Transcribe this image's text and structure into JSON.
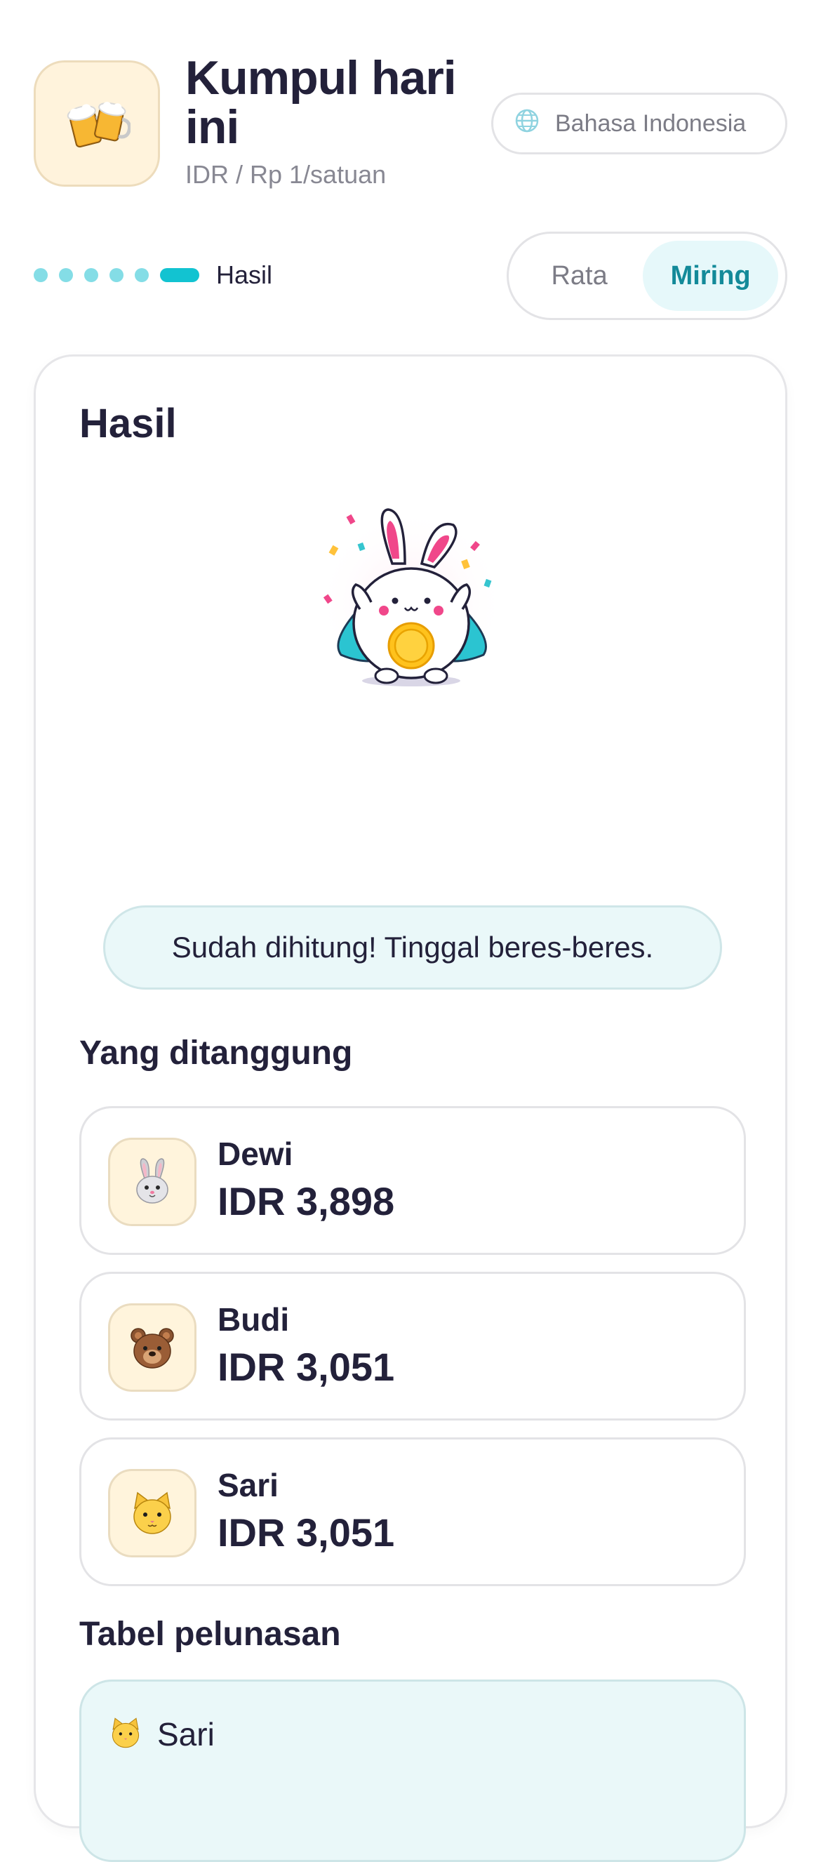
{
  "header": {
    "app_icon": "beer-mugs-icon",
    "title": "Kumpul hari ini",
    "subtitle": "IDR / Rp 1/satuan",
    "language": "Bahasa Indonesia"
  },
  "steps": {
    "total": 6,
    "current": 6,
    "label": "Hasil"
  },
  "mode": {
    "options": [
      "Rata",
      "Miring"
    ],
    "selected": "Miring"
  },
  "result": {
    "title": "Hasil",
    "mascot": "bunny-with-coin-illustration",
    "banner": "Sudah dihitung! Tinggal beres-beres."
  },
  "shares": {
    "title": "Yang ditanggung",
    "people": [
      {
        "name": "Dewi",
        "amount": "IDR 3,898",
        "avatar": "rabbit-face-icon"
      },
      {
        "name": "Budi",
        "amount": "IDR 3,051",
        "avatar": "bear-face-icon"
      },
      {
        "name": "Sari",
        "amount": "IDR 3,051",
        "avatar": "cat-face-icon"
      }
    ]
  },
  "settlement": {
    "title": "Tabel pelunasan",
    "rows": [
      {
        "name": "Sari",
        "avatar": "cat-face-icon"
      }
    ]
  },
  "colors": {
    "accent": "#12c3d1",
    "accent_soft": "#e6f8fa",
    "avatar_bg": "#fff4dc",
    "text": "#23213a",
    "muted": "#888893"
  }
}
